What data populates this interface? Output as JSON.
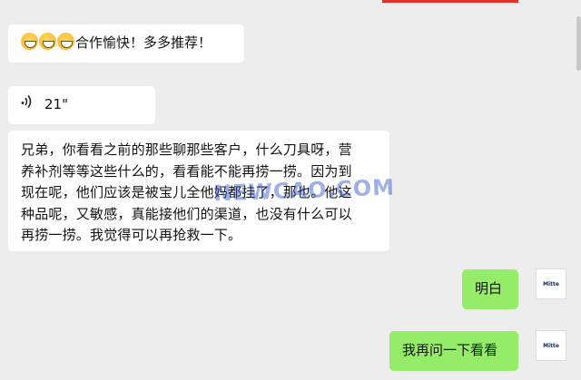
{
  "messages": {
    "msg1": {
      "text": "合作愉快！多多推荐！",
      "emoji_count": 3,
      "emoji_name": "grinning-face"
    },
    "voice": {
      "duration": "21\""
    },
    "long": {
      "line1": "兄弟，你看看之前的那些聊那些客户，什么刀具呀，营",
      "line2": "养补剂等等这些什么的，看看能不能再捞一捞。因为到",
      "line3": "现在呢，他们应该是被宝儿全他妈都挂了，那也。他这",
      "line4": "种品呢，又敏感，真能接他们的渠道，也没有什么可以",
      "line5": "再捞一捞。我觉得可以再抢救一下。"
    },
    "reply1": {
      "text": "明白"
    },
    "reply2": {
      "text": "我再问一下看看"
    }
  },
  "watermark": "NEWCAO.COM",
  "avatar_logo": "Mitte",
  "colors": {
    "green_bubble": "#95ec69",
    "background": "#ededed",
    "white_bubble": "#ffffff"
  }
}
